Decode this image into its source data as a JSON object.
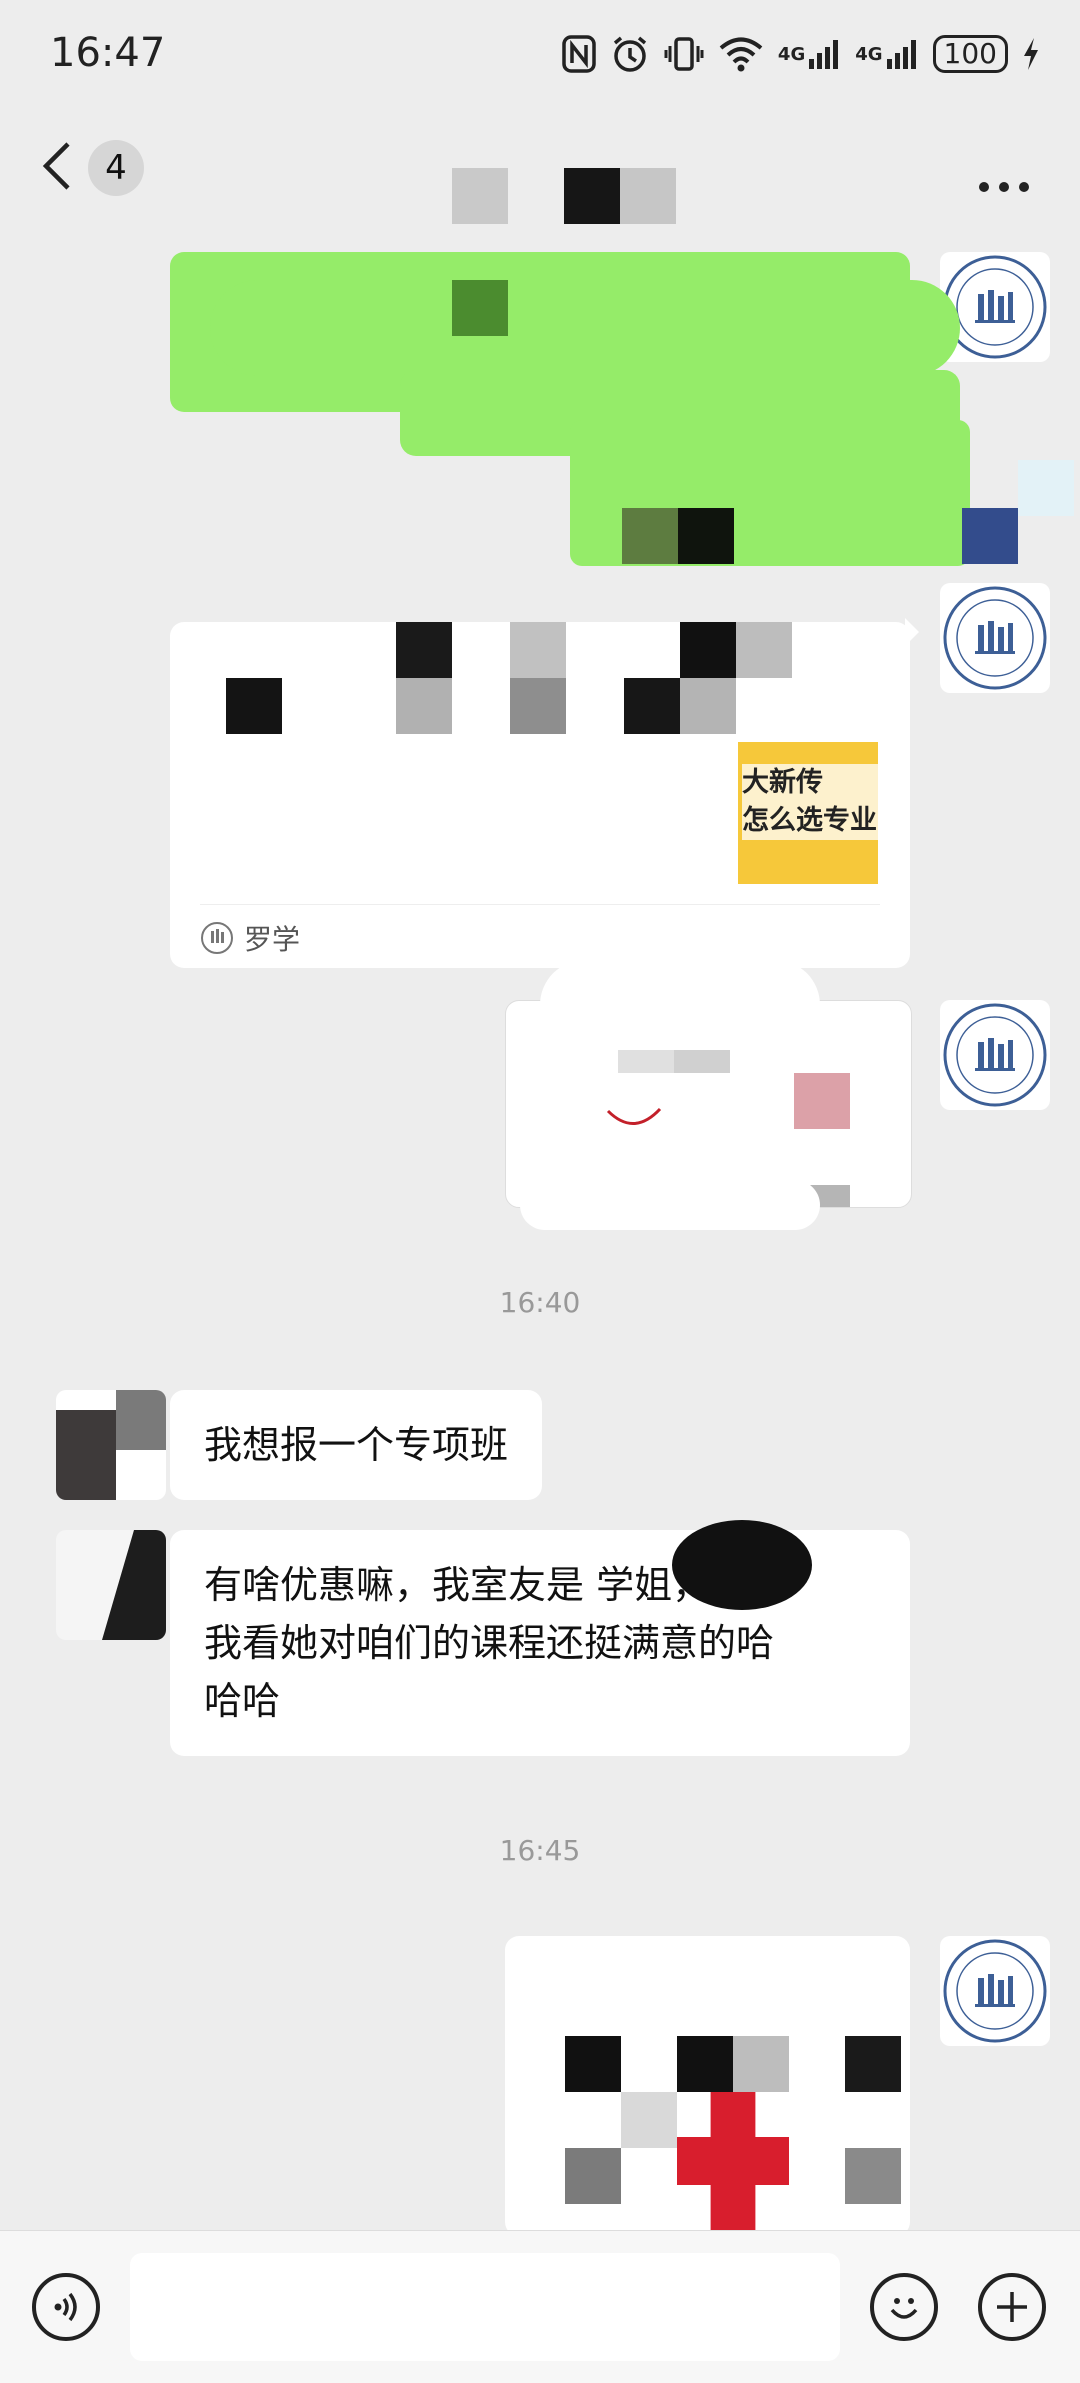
{
  "status_bar": {
    "time": "16:47",
    "icons": [
      "nfc-icon",
      "alarm-icon",
      "vibrate-icon",
      "wifi-icon",
      "4g-signal-icon",
      "4g-signal-icon-2"
    ],
    "network_labels": [
      "4G",
      "4G"
    ],
    "battery": "100"
  },
  "header": {
    "unread_count": "4"
  },
  "messages": {
    "article_card_source": "罗学",
    "article_thumb_text": "大新传\n怎么选专业",
    "timestamp_1": "16:40",
    "incoming_1": "我想报一个专项班",
    "incoming_2": "有啥优惠嘛，我室友是 学姐，\n我看她对咱们的课程还挺满意的哈\n哈哈",
    "timestamp_2": "16:45"
  },
  "colors": {
    "background": "#ededed",
    "sent_bubble": "#95ec69",
    "received_bubble": "#ffffff",
    "logo_blue": "#3d5f96"
  }
}
